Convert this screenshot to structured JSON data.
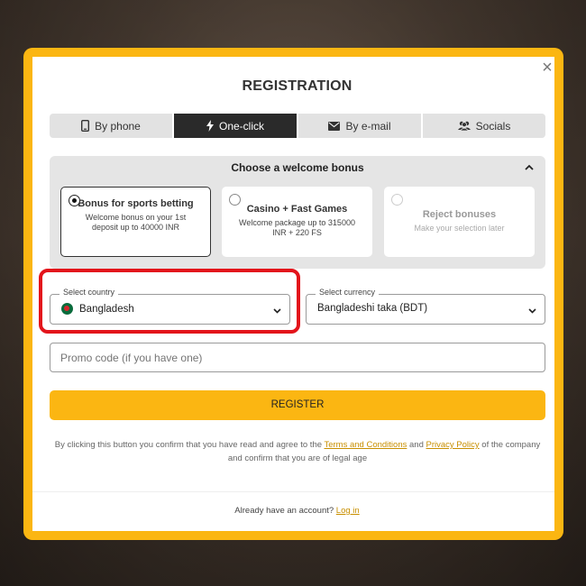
{
  "modal": {
    "title": "REGISTRATION",
    "close_glyph": "×"
  },
  "tabs": [
    {
      "label": "By phone",
      "icon": "phone-icon",
      "active": false
    },
    {
      "label": "One-click",
      "icon": "lightning-icon",
      "active": true
    },
    {
      "label": "By e-mail",
      "icon": "envelope-icon",
      "active": false
    },
    {
      "label": "Socials",
      "icon": "users-icon",
      "active": false
    }
  ],
  "bonus": {
    "heading": "Choose a welcome bonus",
    "options": [
      {
        "title": "Bonus for sports betting",
        "subtitle": "Welcome bonus on your 1st deposit up to 40000 INR",
        "selected": true
      },
      {
        "title": "Casino + Fast Games",
        "subtitle": "Welcome package up to 315000 INR + 220 FS",
        "selected": false
      },
      {
        "title": "Reject bonuses",
        "subtitle": "Make your selection later",
        "selected": false
      }
    ]
  },
  "country": {
    "label": "Select country",
    "value": "Bangladesh"
  },
  "currency": {
    "label": "Select currency",
    "value": "Bangladeshi taka (BDT)"
  },
  "promo": {
    "placeholder": "Promo code (if you have one)"
  },
  "register_label": "REGISTER",
  "legal": {
    "prefix": "By clicking this button you confirm that you have read and agree to the",
    "terms_link": "Terms and Conditions",
    "and": "and",
    "privacy_link": "Privacy Policy",
    "suffix": "of the company and confirm that you are of legal age"
  },
  "footer": {
    "text": "Already have an account?",
    "login_link": "Log in"
  },
  "colors": {
    "accent": "#fbb612",
    "highlight": "#e3141b",
    "active_tab": "#2a2a2a",
    "link": "#c88f00"
  }
}
